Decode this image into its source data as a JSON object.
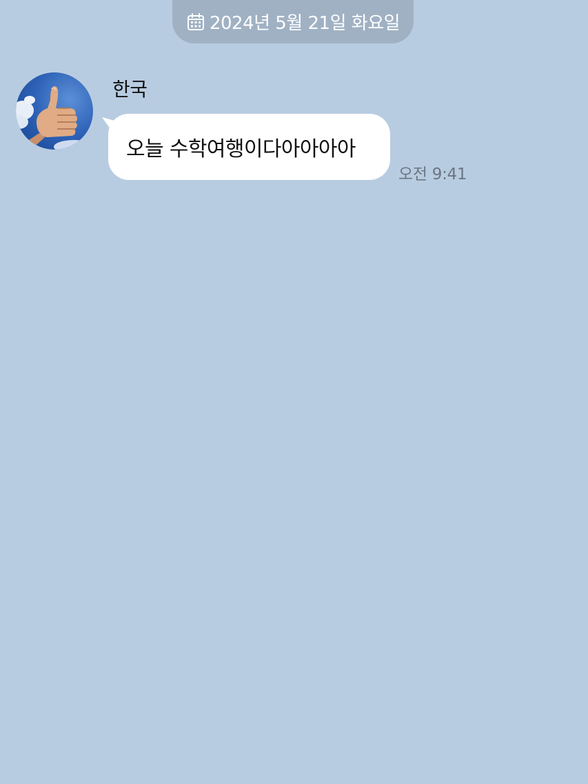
{
  "date_divider": {
    "icon": "calendar-icon",
    "text": "2024년 5월 21일 화요일"
  },
  "message": {
    "sender": "한국",
    "avatar_icon": "thumbs-up-photo",
    "text": "오늘 수학여행이다아아아아",
    "time": "오전 9:41"
  },
  "colors": {
    "background": "#b8cce1",
    "date_pill": "#a0b1c4",
    "bubble": "#ffffff",
    "time_text": "#6b7684"
  }
}
